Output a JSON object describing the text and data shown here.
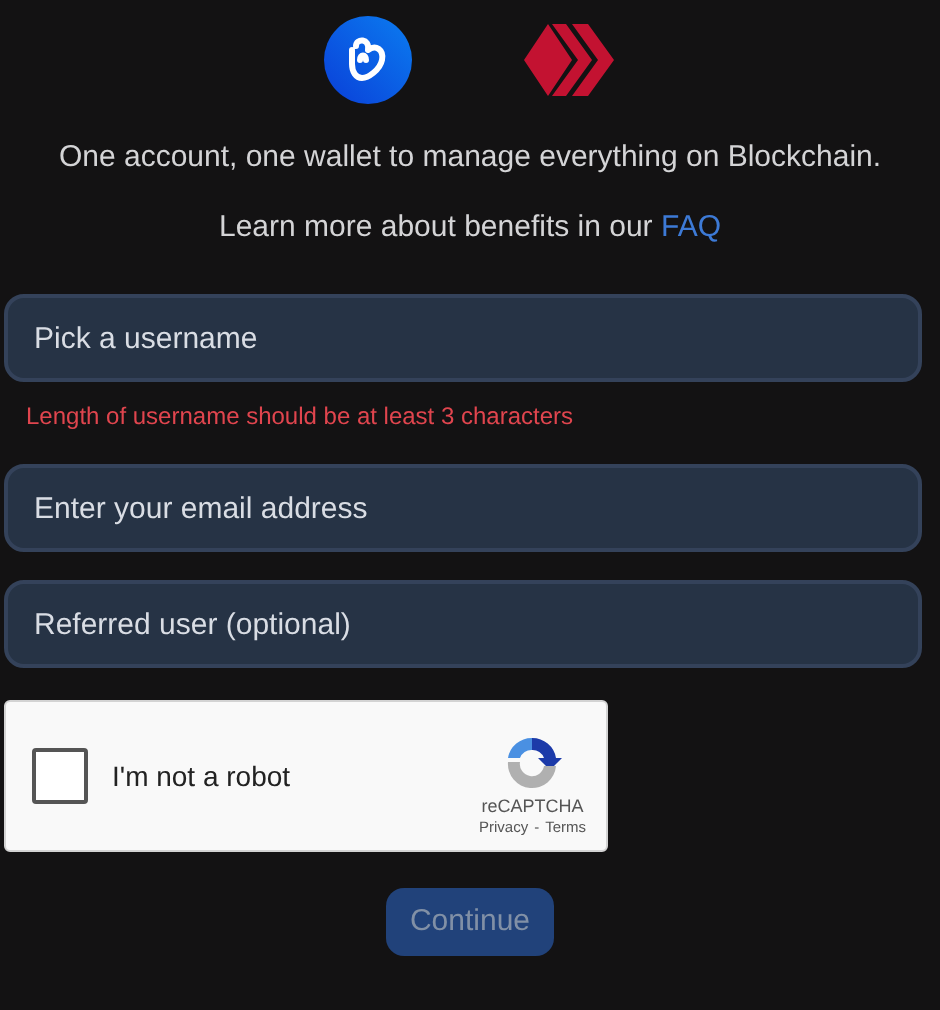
{
  "tagline": "One account, one wallet to manage everything on Blockchain.",
  "learn_more": {
    "text": "Learn more about benefits in our",
    "link": "FAQ"
  },
  "fields": [
    {
      "placeholder": "Pick a username",
      "error": "Length of username should be at least 3 characters"
    },
    {
      "placeholder": "Enter your email address"
    },
    {
      "placeholder": "Referred user (optional)"
    }
  ],
  "captcha": {
    "label": "I'm not a robot",
    "checked": false,
    "brand": "reCAPTCHA",
    "privacy": "Privacy",
    "separator": "-",
    "terms": "Terms"
  },
  "continue_button": {
    "label": "Continue",
    "disabled": true
  }
}
